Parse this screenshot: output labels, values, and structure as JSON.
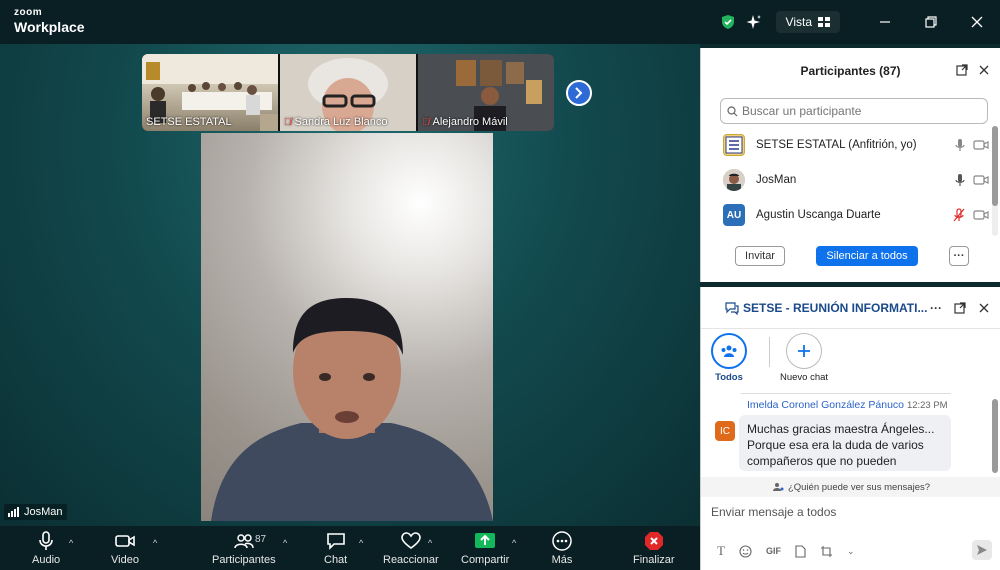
{
  "app": {
    "brand_small": "zoom",
    "brand_large": "Workplace",
    "view_label": "Vista"
  },
  "stage": {
    "thumbnails": [
      {
        "name": "SETSE ESTATAL",
        "muted": false
      },
      {
        "name": "Sandra Luz Blanco",
        "muted": true
      },
      {
        "name": "Alejandro Mávil",
        "muted": true
      }
    ],
    "speaker_name": "JosMan"
  },
  "toolbar": {
    "audio": "Audio",
    "video": "Video",
    "participants": "Participantes",
    "participants_count": "87",
    "chat": "Chat",
    "react": "Reaccionar",
    "share": "Compartir",
    "more": "Más",
    "end": "Finalizar"
  },
  "participants_panel": {
    "title": "Participantes (87)",
    "search_placeholder": "Buscar un participante",
    "rows": [
      {
        "name": "SETSE ESTATAL (Anfitrión, yo)",
        "avatar": "",
        "mic_muted": false
      },
      {
        "name": "JosMan",
        "avatar": "",
        "mic_muted": false
      },
      {
        "name": "Agustin Uscanga Duarte",
        "avatar": "AU",
        "mic_muted": true
      }
    ],
    "invite_button": "Invitar",
    "mute_all_button": "Silenciar a todos",
    "more_button": "···"
  },
  "chat_panel": {
    "title": "SETSE - REUNIÓN INFORMATI...",
    "tabs": [
      {
        "label": "Todos"
      },
      {
        "label": "Nuevo chat"
      }
    ],
    "message": {
      "initials": "IC",
      "sender": "Imelda Coronel González Pánuco",
      "time": "12:23 PM",
      "text": "Muchas gracias maestra Ángeles... Porque esa era la duda de varios compañeros que no pueden"
    },
    "who_can_see": "¿Quién puede ver sus mensajes?",
    "compose_placeholder": "Enviar mensaje a todos",
    "gif_label": "GIF"
  },
  "colors": {
    "accent": "#0e72ed",
    "share_green": "#12b85a",
    "end_red": "#e02828"
  }
}
